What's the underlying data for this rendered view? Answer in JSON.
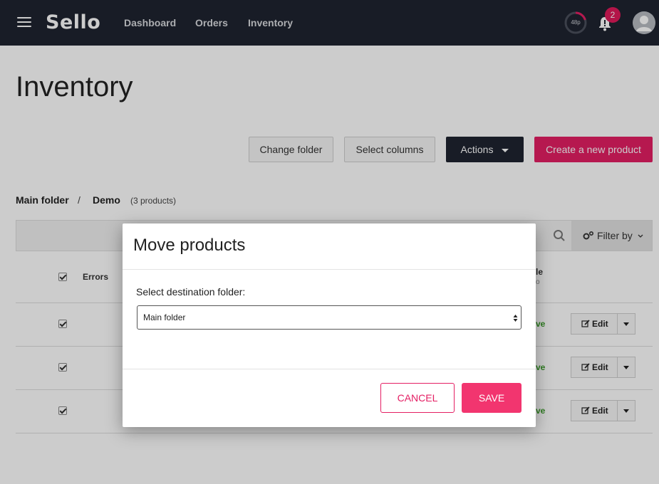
{
  "app": {
    "logo": "Sello"
  },
  "nav": {
    "links": [
      "Dashboard",
      "Orders",
      "Inventory"
    ]
  },
  "header": {
    "progress_label": "48p",
    "notification_count": "2"
  },
  "page": {
    "title": "Inventory"
  },
  "toolbar_buttons": {
    "change_folder": "Change folder",
    "select_columns": "Select columns",
    "actions": "Actions",
    "create": "Create a new product"
  },
  "breadcrumb": {
    "root": "Main folder",
    "separator": "/",
    "current": "Demo",
    "count": "(3 products)"
  },
  "filter": {
    "label": "Filter by"
  },
  "table": {
    "headers": {
      "errors": "Errors",
      "partial_header": "le",
      "partial_sub": "o"
    },
    "rows": [
      {
        "status": "ve",
        "edit": "Edit"
      },
      {
        "status": "ve",
        "edit": "Edit"
      },
      {
        "status": "ve",
        "edit": "Edit"
      }
    ]
  },
  "modal": {
    "title": "Move products",
    "field_label": "Select destination folder:",
    "selected_folder": "Main folder",
    "cancel_label": "CANCEL",
    "save_label": "SAVE"
  },
  "colors": {
    "navbar": "#1f2330",
    "accent": "#e41e63",
    "status_green": "#3a9c2a"
  },
  "icons": [
    "menu-icon",
    "progress-ring-icon",
    "bell-icon",
    "avatar-icon",
    "search-icon",
    "gears-icon",
    "chevron-down-icon",
    "edit-icon",
    "caret-down-icon",
    "select-arrows-icon"
  ]
}
